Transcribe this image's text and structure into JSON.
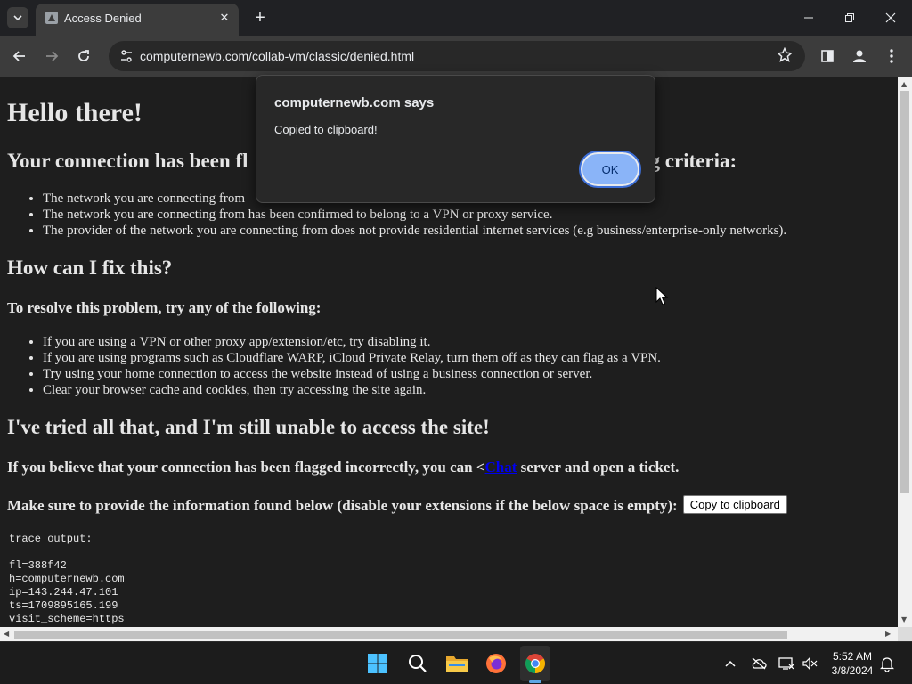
{
  "browser": {
    "tab_title": "Access Denied",
    "tab_close": "✕",
    "new_tab": "+",
    "url": "computernewb.com/collab-vm/classic/denied.html"
  },
  "page": {
    "heading": "Hello there!",
    "flag_heading_left": "Your connection has been fl",
    "flag_heading_right": "ne following criteria:",
    "criteria": [
      "The network you are connecting from",
      "The network you are connecting from has been confirmed to belong to a VPN or proxy service.",
      "The provider of the network you are connecting from does not provide residential internet services (e.g business/enterprise-only networks)."
    ],
    "fix_heading": "How can I fix this?",
    "resolve_heading": "To resolve this problem, try any of the following:",
    "fixes": [
      "If you are using a VPN or other proxy app/extension/etc, try disabling it.",
      "If you are using programs such as Cloudflare WARP, iCloud Private Relay, turn them off as they can flag as a VPN.",
      "Try using your home connection to access the website instead of using a business connection or server.",
      "Clear your browser cache and cookies, then try accessing the site again."
    ],
    "tried_heading": "I've tried all that, and I'm still unable to access the site!",
    "incorrect_prefix": "If you believe that your connection has been flagged incorrectly, you can <",
    "incorrect_link": "Chat",
    "incorrect_suffix": " server and open a ticket.",
    "provide_text": "Make sure to provide the information found below (disable your extensions if the below space is empty):",
    "copy_button": "Copy to clipboard",
    "trace_output": "trace output:\n\nfl=388f42\nh=computernewb.com\nip=143.244.47.101\nts=1709895165.199\nvisit_scheme=https"
  },
  "dialog": {
    "title": "computernewb.com says",
    "message": "Copied to clipboard!",
    "ok_label": "OK"
  },
  "taskbar": {
    "time": "5:52 AM",
    "date": "3/8/2024"
  },
  "colors": {
    "page_bg": "#1e1e1e",
    "dialog_ok": "#8ab4f8",
    "link": "#0000ee"
  }
}
